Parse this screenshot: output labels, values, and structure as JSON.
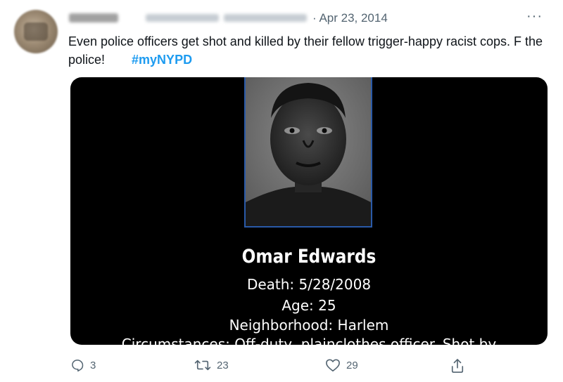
{
  "tweet": {
    "date": "· Apr 23, 2014",
    "more_label": "···",
    "text": "Even police officers get shot and killed by their fellow trigger-happy racist cops. F the police!",
    "hashtag": "#myNYPD"
  },
  "media": {
    "name": "Omar Edwards",
    "death": "Death: 5/28/2008",
    "age": "Age: 25",
    "neighborhood": "Neighborhood: Harlem",
    "circumstances": "Circumstances: Off-duty, plainclothes officer. Shot by"
  },
  "actions": {
    "reply_count": "3",
    "retweet_count": "23",
    "like_count": "29"
  },
  "colors": {
    "accent": "#1d9bf0",
    "secondary_text": "#536471",
    "photo_border": "#2a5aa8"
  },
  "icons": [
    "reply-icon",
    "retweet-icon",
    "like-icon",
    "share-icon",
    "more-icon"
  ]
}
